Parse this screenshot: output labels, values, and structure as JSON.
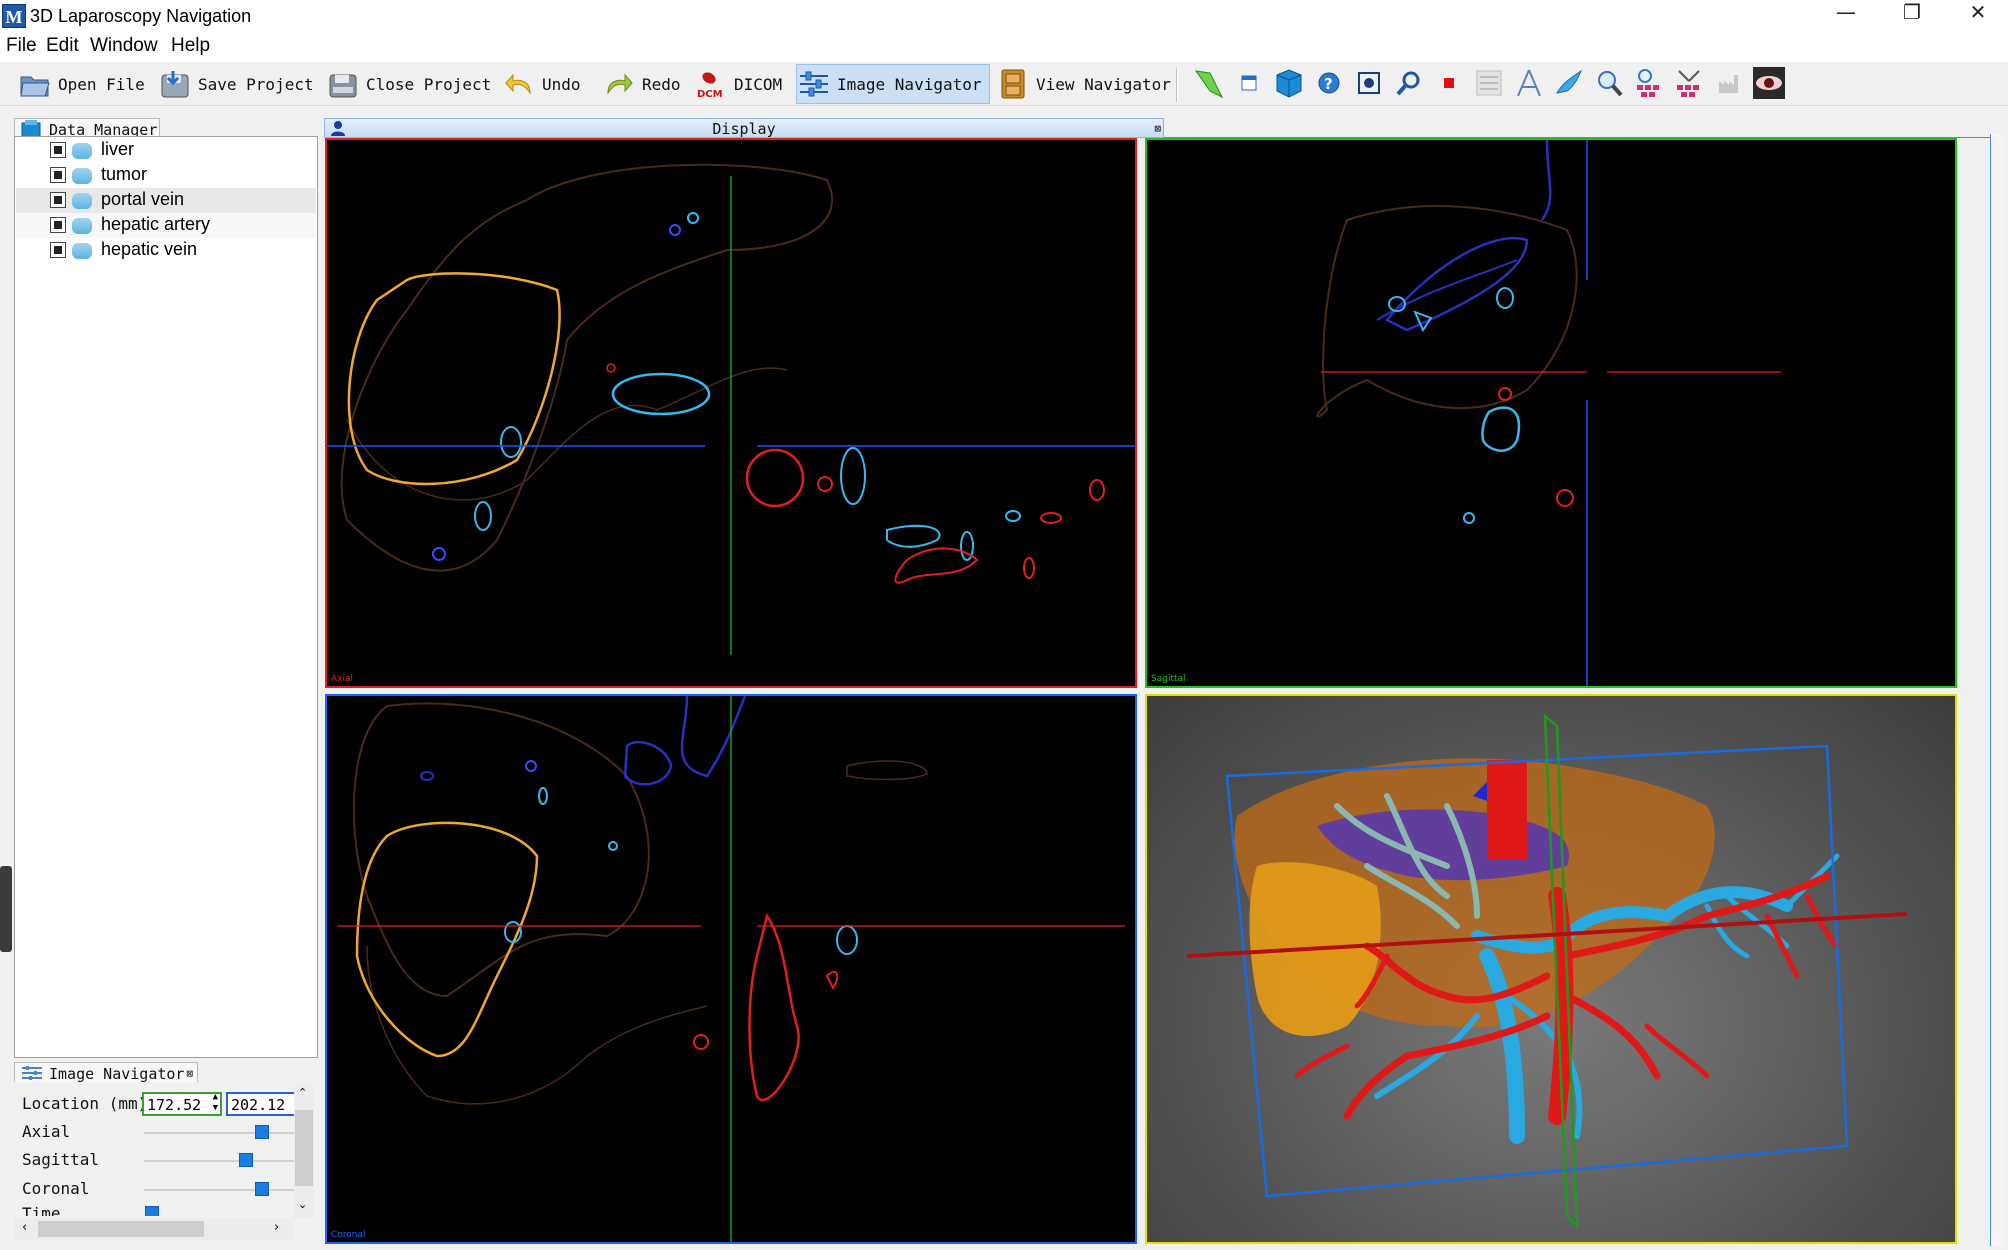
{
  "window": {
    "title": "3D Laparoscopy Navigation",
    "controls": [
      "—",
      "❐",
      "✕"
    ]
  },
  "menu": [
    "File",
    "Edit",
    "Window",
    "Help"
  ],
  "toolbar": {
    "open_file": "Open File",
    "save_project": "Save Project",
    "close_project": "Close Project",
    "undo": "Undo",
    "redo": "Redo",
    "dicom": "DICOM",
    "image_navigator": "Image Navigator",
    "view_navigator": "View Navigator"
  },
  "data_manager": {
    "tab": "Data Manager",
    "items": [
      {
        "label": "liver"
      },
      {
        "label": "tumor"
      },
      {
        "label": "portal vein"
      },
      {
        "label": "hepatic artery"
      },
      {
        "label": "hepatic vein"
      }
    ]
  },
  "image_navigator": {
    "tab": "Image Navigator",
    "location_label": "Location (mm)",
    "location_x": "172.52",
    "location_y": "202.12",
    "axial": "Axial",
    "sagittal": "Sagittal",
    "coronal": "Coronal",
    "time": "Time",
    "levels": {
      "axial": 0.74,
      "sagittal": 0.64,
      "coronal": 0.74,
      "time": 0.05
    }
  },
  "display": {
    "title": "Display",
    "views": {
      "axial": "Axial",
      "sagittal": "Sagittal",
      "coronal": "Coronal"
    },
    "colors": {
      "axial": "#e02020",
      "sagittal": "#20c020",
      "coronal": "#2060ff",
      "render": "#e0e000"
    }
  }
}
